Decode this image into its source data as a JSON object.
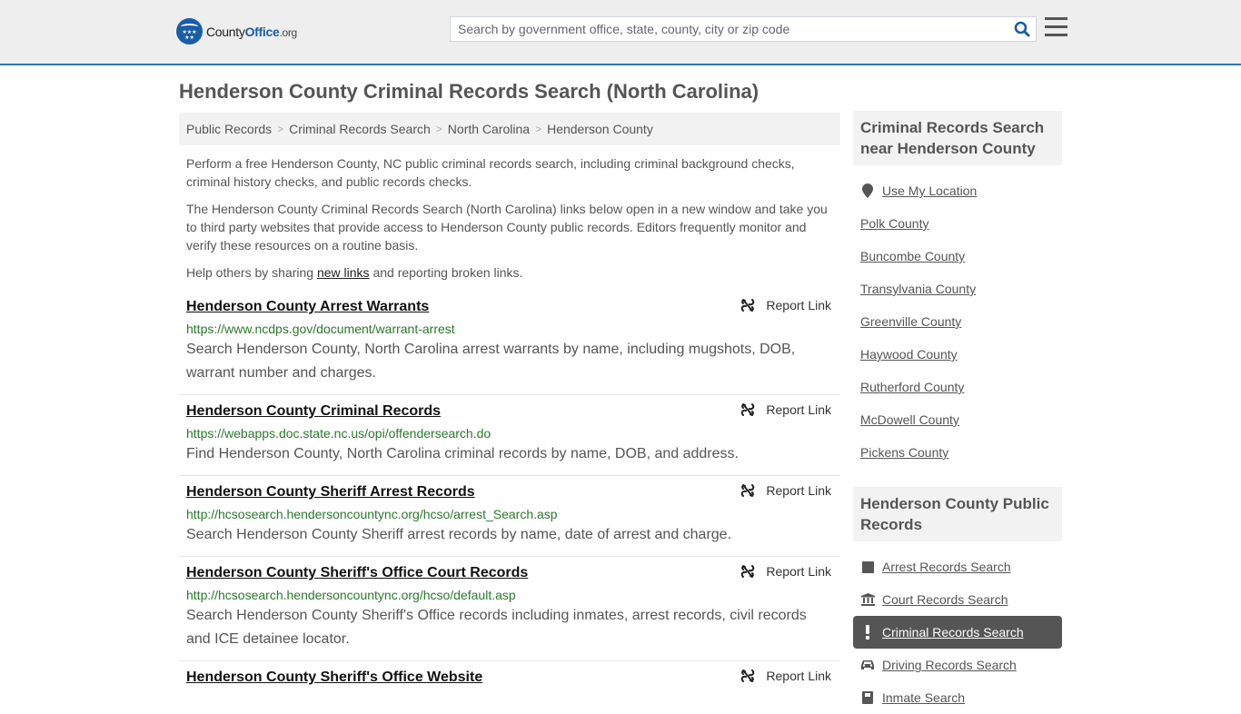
{
  "header": {
    "logo": {
      "prefix": "County",
      "brand": "Office",
      "tld": ".org"
    },
    "search": {
      "placeholder": "Search by government office, state, county, city or zip code",
      "value": ""
    },
    "accent_color": "#2e78b4"
  },
  "page_title": "Henderson County Criminal Records Search (North Carolina)",
  "breadcrumb": [
    "Public Records",
    "Criminal Records Search",
    "North Carolina",
    "Henderson County"
  ],
  "intro": {
    "p1": "Perform a free Henderson County, NC public criminal records search, including criminal background checks, criminal history checks, and public records checks.",
    "p2": "The Henderson County Criminal Records Search (North Carolina) links below open in a new window and take you to third party websites that provide access to Henderson County public records. Editors frequently monitor and verify these resources on a routine basis.",
    "p3_before": "Help others by sharing ",
    "p3_link": "new links",
    "p3_after": " and reporting broken links."
  },
  "report_label": "Report Link",
  "results": [
    {
      "title": "Henderson County Arrest Warrants",
      "url": "https://www.ncdps.gov/document/warrant-arrest",
      "description": "Search Henderson County, North Carolina arrest warrants by name, including mugshots, DOB, warrant number and charges."
    },
    {
      "title": "Henderson County Criminal Records",
      "url": "https://webapps.doc.state.nc.us/opi/offendersearch.do",
      "description": "Find Henderson County, North Carolina criminal records by name, DOB, and address."
    },
    {
      "title": "Henderson County Sheriff Arrest Records",
      "url": "http://hcsosearch.hendersoncountync.org/hcso/arrest_Search.asp",
      "description": "Search Henderson County Sheriff arrest records by name, date of arrest and charge."
    },
    {
      "title": "Henderson County Sheriff's Office Court Records",
      "url": "http://hcsosearch.hendersoncountync.org/hcso/default.asp",
      "description": "Search Henderson County Sheriff's Office records including inmates, arrest records, civil records and ICE detainee locator."
    },
    {
      "title": "Henderson County Sheriff's Office Website",
      "url": "",
      "description": ""
    }
  ],
  "sidebar": {
    "nearby": {
      "heading": "Criminal Records Search near Henderson County",
      "use_location": "Use My Location",
      "counties": [
        "Polk County",
        "Buncombe County",
        "Transylvania County",
        "Greenville County",
        "Haywood County",
        "Rutherford County",
        "McDowell County",
        "Pickens County"
      ]
    },
    "public_records": {
      "heading": "Henderson County Public Records",
      "items": [
        {
          "label": "Arrest Records Search",
          "icon": "square-icon",
          "active": false
        },
        {
          "label": "Court Records Search",
          "icon": "courthouse-icon",
          "active": false
        },
        {
          "label": "Criminal Records Search",
          "icon": "exclamation-icon",
          "active": true
        },
        {
          "label": "Driving Records Search",
          "icon": "car-icon",
          "active": false
        },
        {
          "label": "Inmate Search",
          "icon": "inmate-icon",
          "active": false
        }
      ]
    }
  }
}
